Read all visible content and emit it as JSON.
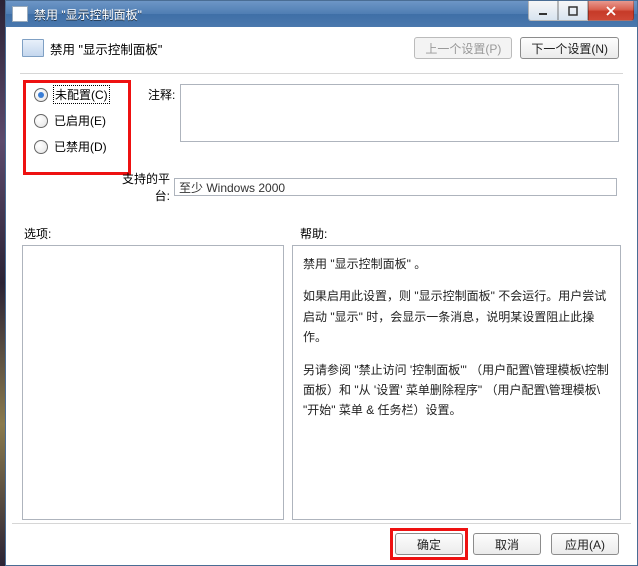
{
  "titlebar": {
    "title": "禁用 \"显示控制面板\""
  },
  "header": {
    "title": "禁用 \"显示控制面板\"",
    "prev_label": "上一个设置(P)",
    "next_label": "下一个设置(N)"
  },
  "radios": {
    "not_configured": "未配置(C)",
    "enabled": "已启用(E)",
    "disabled": "已禁用(D)"
  },
  "labels": {
    "comment": "注释:",
    "platform": "支持的平台:",
    "options": "选项:",
    "help": "帮助:"
  },
  "platform_text": "至少 Windows 2000",
  "help_text": {
    "p1": "禁用 \"显示控制面板\" 。",
    "p2": "如果启用此设置，则 \"显示控制面板\" 不会运行。用户尝试启动 \"显示\" 时，会显示一条消息，说明某设置阻止此操作。",
    "p3": "另请参阅 \"禁止访问 '控制面板'\" （用户配置\\管理模板\\控制面板）和 \"从 '设置' 菜单删除程序\" （用户配置\\管理模板\\ \"开始\" 菜单 & 任务栏）设置。"
  },
  "footer": {
    "ok": "确定",
    "cancel": "取消",
    "apply": "应用(A)"
  }
}
